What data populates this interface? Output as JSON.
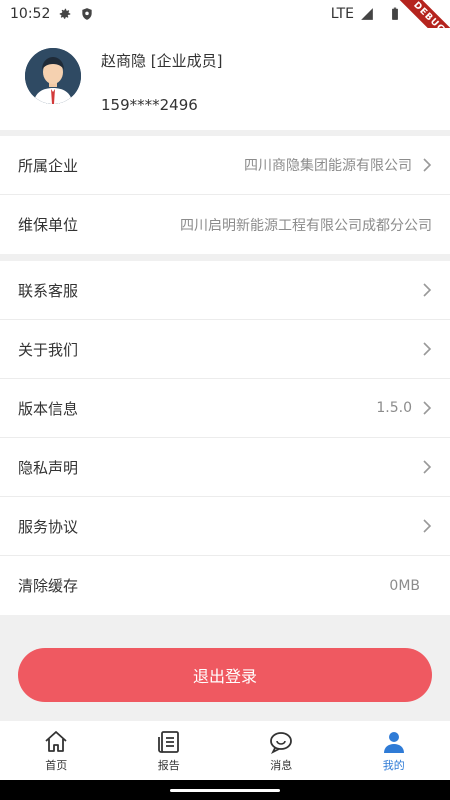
{
  "status_bar": {
    "time": "10:52",
    "network": "LTE",
    "debug_label": "DEBUG"
  },
  "profile": {
    "name": "赵商隐 [企业成员]",
    "phone": "159****2496"
  },
  "company_group": [
    {
      "label": "所属企业",
      "value": "四川商隐集团能源有限公司",
      "chevron": true
    },
    {
      "label": "维保单位",
      "value": "四川启明新能源工程有限公司成都分公司",
      "chevron": false
    }
  ],
  "settings_group": [
    {
      "label": "联系客服",
      "value": "",
      "chevron": true
    },
    {
      "label": "关于我们",
      "value": "",
      "chevron": true
    },
    {
      "label": "版本信息",
      "value": "1.5.0",
      "chevron": true
    },
    {
      "label": "隐私声明",
      "value": "",
      "chevron": true
    },
    {
      "label": "服务协议",
      "value": "",
      "chevron": true
    },
    {
      "label": "清除缓存",
      "value": "0MB",
      "chevron": false
    }
  ],
  "logout_label": "退出登录",
  "tabbar": [
    {
      "label": "首页",
      "icon": "home-icon",
      "active": false
    },
    {
      "label": "报告",
      "icon": "report-icon",
      "active": false
    },
    {
      "label": "消息",
      "icon": "message-icon",
      "active": false
    },
    {
      "label": "我的",
      "icon": "user-icon",
      "active": true
    }
  ],
  "colors": {
    "accent": "#2f7bd6",
    "logout": "#ef5961"
  }
}
